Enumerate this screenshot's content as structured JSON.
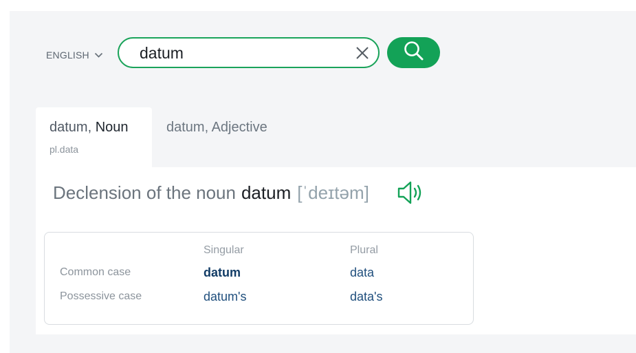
{
  "search": {
    "language": "ENGLISH",
    "query": "datum"
  },
  "tabs": [
    {
      "word": "datum, ",
      "pos": "Noun",
      "sub": "pl.data"
    },
    {
      "label": "datum, Adjective"
    }
  ],
  "declension": {
    "prefix": "Declension of the noun",
    "word": "datum",
    "ipa": "[ˈdeɪtəm]",
    "headers": [
      "Singular",
      "Plural"
    ],
    "rows": [
      {
        "label": "Common case",
        "singular": "datum",
        "plural": "data"
      },
      {
        "label": "Possessive case",
        "singular": "datum's",
        "plural": "data's"
      }
    ]
  },
  "colors": {
    "accent": "#13a257",
    "link": "#204f7d"
  },
  "icons": [
    "chevron-down-icon",
    "close-icon",
    "search-icon",
    "speaker-icon"
  ]
}
